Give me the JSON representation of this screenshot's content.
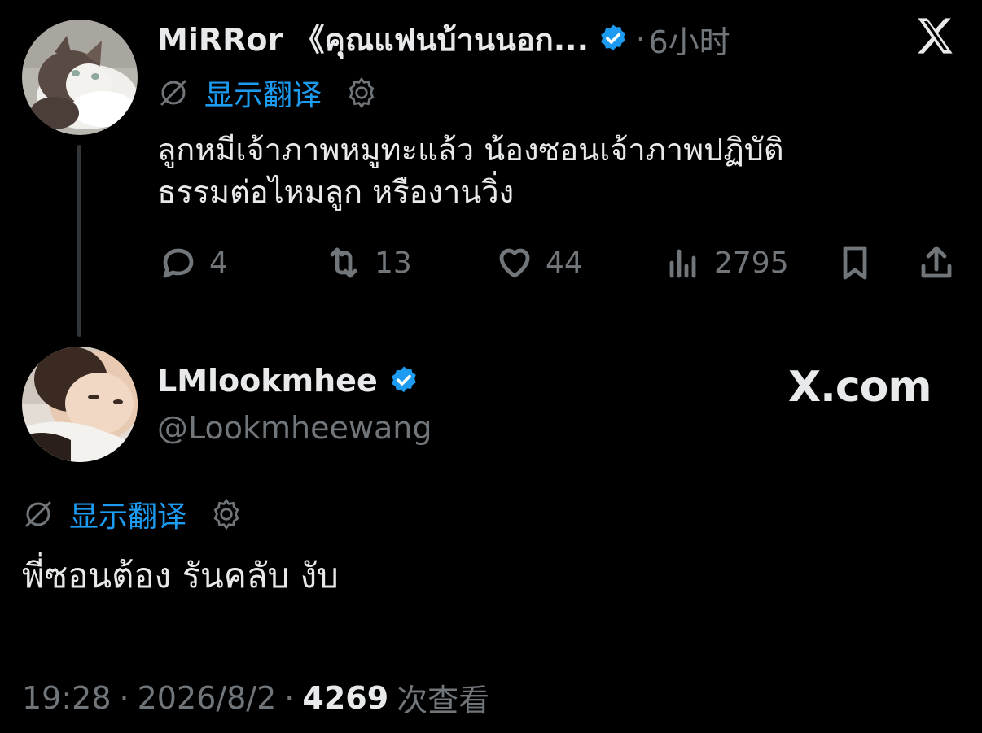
{
  "parent_tweet": {
    "author_name": "MiRRor 《คุณแฟนบ้านนอก...",
    "separator": "·",
    "time_ago": "6小时",
    "translate_label": "显示翻译",
    "text_line1": "ลูกหมีเจ้าภาพหมูทะแล้ว น้องซอนเจ้าภาพปฏิบัติ",
    "text_line2": "ธรรมต่อไหมลูก หรืองานวิ่ง",
    "replies": "4",
    "retweets": "13",
    "likes": "44",
    "views": "2795"
  },
  "main_tweet": {
    "author_name": "LMlookmhee",
    "handle": "@Lookmheewang",
    "translate_label": "显示翻译",
    "text": "พี่ซอนต้อง รันคลับ งับ",
    "time": "19:28",
    "date": "2026/8/2",
    "view_count": "4269",
    "views_label": "次查看",
    "separator": "·"
  },
  "branding": {
    "x_logo": "x-logo-icon",
    "watermark": "X.com"
  },
  "colors": {
    "background": "#000000",
    "text": "#e7e9ea",
    "muted": "#71767b",
    "accent": "#1d9bf0"
  }
}
